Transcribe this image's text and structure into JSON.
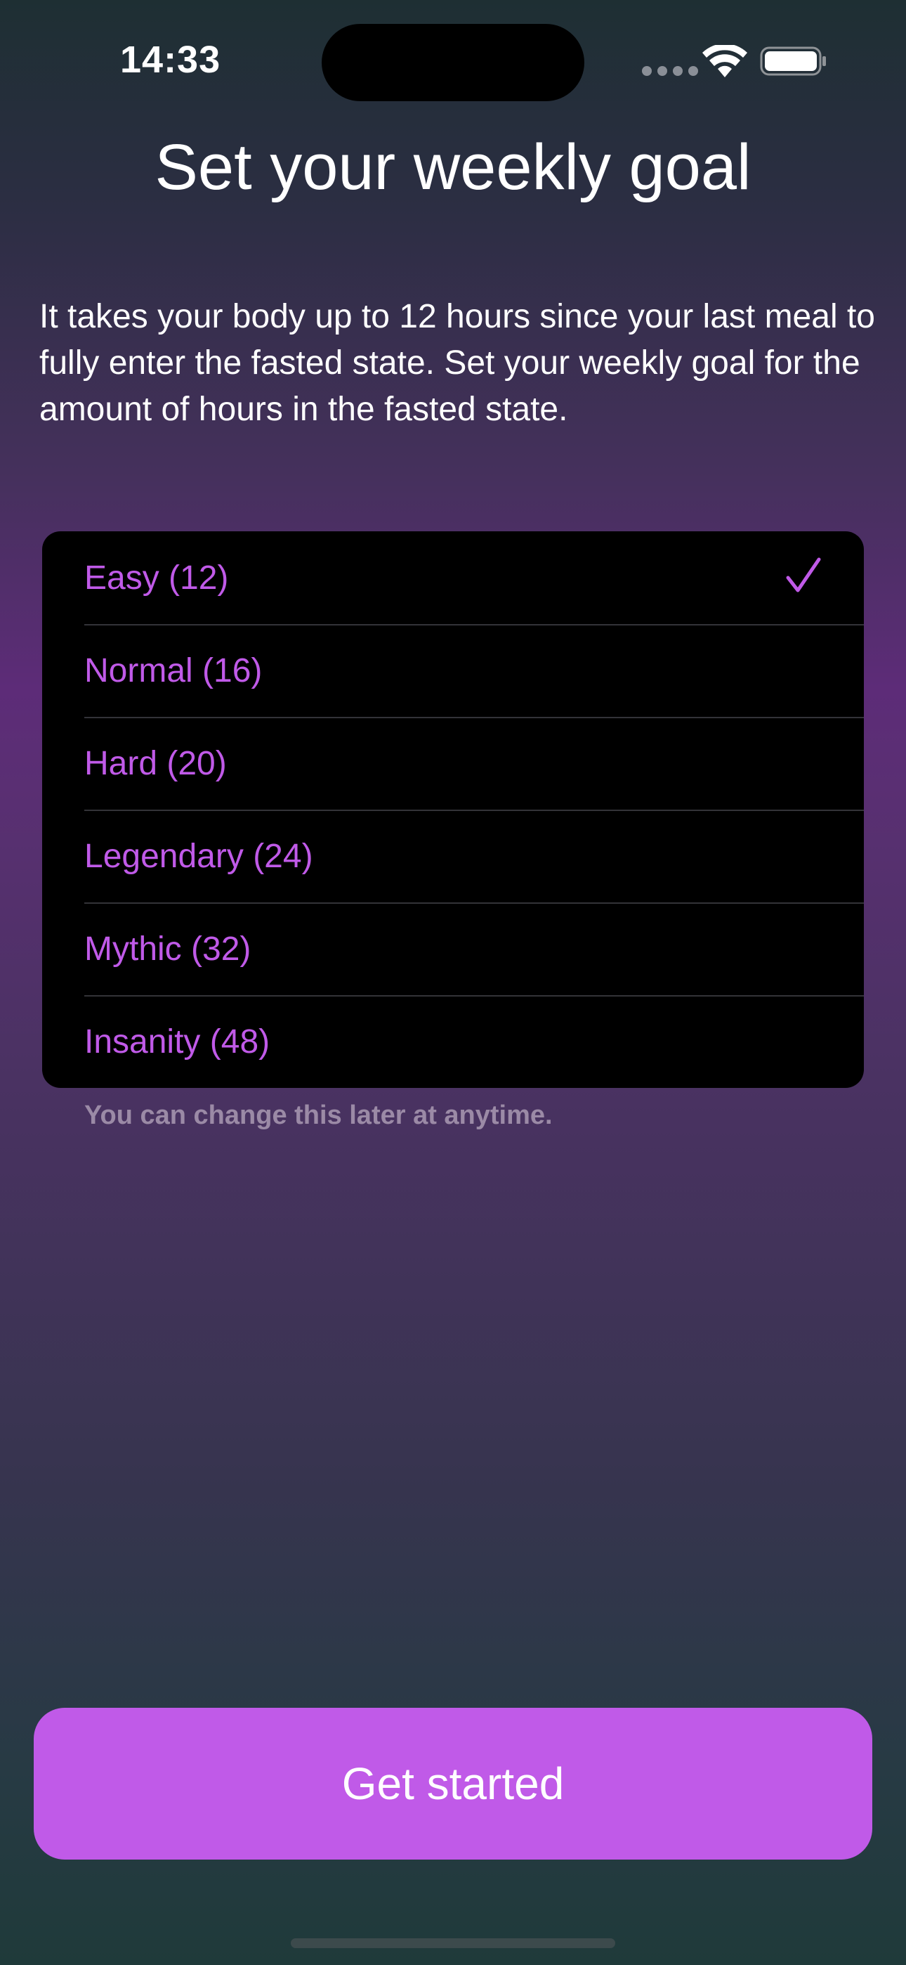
{
  "status_bar": {
    "time": "14:33"
  },
  "title": "Set your weekly goal",
  "description": "It takes your body up to 12 hours since your last meal to fully enter the fasted state. Set your weekly goal for the amount of hours in the fasted state.",
  "options": [
    {
      "label": "Easy (12)",
      "selected": true
    },
    {
      "label": "Normal (16)",
      "selected": false
    },
    {
      "label": "Hard (20)",
      "selected": false
    },
    {
      "label": "Legendary (24)",
      "selected": false
    },
    {
      "label": "Mythic (32)",
      "selected": false
    },
    {
      "label": "Insanity (48)",
      "selected": false
    }
  ],
  "footnote": "You can change this later at anytime.",
  "button": {
    "label": "Get started"
  },
  "colors": {
    "accent": "#c05ae8",
    "card_background": "#000000"
  },
  "icons": {
    "wifi": "wifi-icon",
    "battery": "battery-icon",
    "selected_marker": "checkmark-icon"
  }
}
